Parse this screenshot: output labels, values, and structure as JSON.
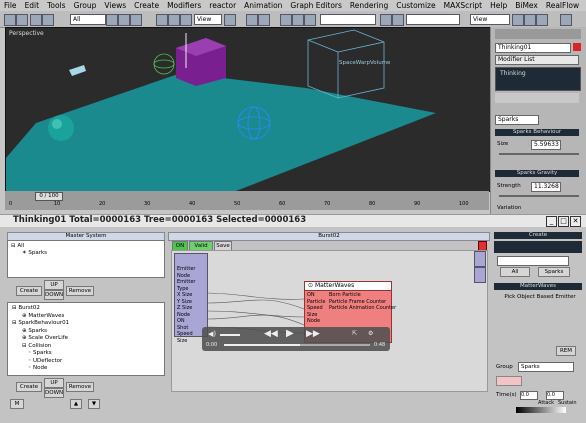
{
  "menu": [
    "File",
    "Edit",
    "Tools",
    "Group",
    "Views",
    "Create",
    "Modifiers",
    "reactor",
    "Animation",
    "Graph Editors",
    "Rendering",
    "Customize",
    "MAXScript",
    "Help",
    "BiMex",
    "RealFlow"
  ],
  "toolbar": {
    "selection_filter": "All",
    "ref_coord": "View",
    "view_combo": "View"
  },
  "viewport": {
    "label": "Perspective",
    "spacewarp_label": "SpaceWarpVolume",
    "colors": {
      "ground": "#1a8a8e",
      "box": "#7a1f8f",
      "sphere": "#1aa39a",
      "helper": "#6ab3d6"
    }
  },
  "timeline": {
    "frame_display": "0 / 100",
    "ticks": [
      "0",
      "10",
      "20",
      "30",
      "40",
      "50",
      "60",
      "70",
      "80",
      "90",
      "100"
    ]
  },
  "command_panel": {
    "object_name": "Thinking01",
    "modifier_list": "Modifier List",
    "stack_item": "Thinking",
    "sub_field": "Sparks",
    "rollout_behaviour": "Sparks Behaviour",
    "size_label": "Size",
    "size_value": "5.59633",
    "rollout_gravity": "Sparks Gravity",
    "strength_label": "Strength",
    "strength_value": "11.3268",
    "variation_label": "Variation"
  },
  "particle_flow": {
    "title": "Thinking01  Total=0000163  Tree=0000163  Selected=0000163",
    "master_system": "Master System",
    "master_tree": [
      "All",
      "Sparks"
    ],
    "create_btn": "Create",
    "remove_btn": "Remove",
    "up_btn": "UP",
    "down_btn": "DOWN",
    "depot": [
      "Burst02",
      "MatterWaves",
      "SparkBehaviour01",
      "Sparks",
      "Scale OverLife",
      "Collision",
      "Sparks",
      "UDeflector",
      "Node"
    ],
    "create_btn2": "Create",
    "remove_btn2": "Remove",
    "up_btn2": "UP",
    "down_btn2": "DOWN",
    "m_btn": "M",
    "event_name": "Burst02",
    "on_btn": "ON",
    "valid_btn": "Valid",
    "save_btn": "Save",
    "emitter_ports": [
      "Emitter Node",
      "Emitter Type",
      "X Size",
      "Y Size",
      "Z Size",
      "Node",
      "ON",
      "Shot",
      "Speed",
      "Size"
    ],
    "node_title": "MatterWaves",
    "node_ports": [
      "ON",
      "Particle",
      "Speed",
      "Size",
      "Node"
    ],
    "node_outputs": [
      "Born Particle",
      "Particle Frame Counter",
      "Particle Animation Counter"
    ],
    "create_panel": "Create",
    "create_all": "All",
    "create_sparks": "Sparks",
    "mw_rollout": "MatterWaves",
    "pick_label": "Pick Object Based Emitter",
    "pick_btn": "REM",
    "group_label": "Group",
    "group_value": "Sparks",
    "time_label": "Time(s)",
    "time_value1": "0.0",
    "time_value2": "0.0",
    "attack_label": "Attack",
    "sustain_label": "Sustain"
  },
  "video": {
    "start_time": "0:00",
    "end_time": "0:48"
  }
}
